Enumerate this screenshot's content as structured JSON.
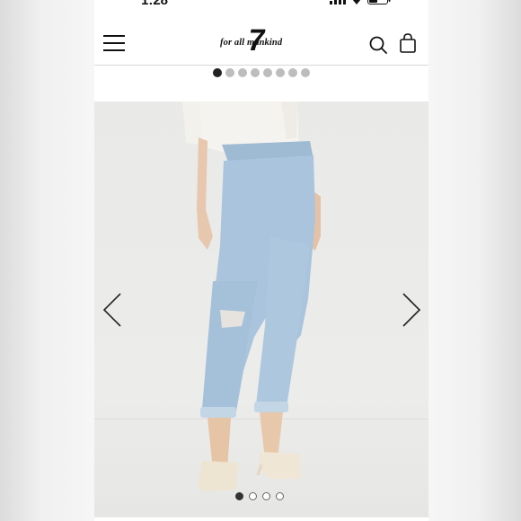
{
  "status_bar": {
    "time": "1:28",
    "icons": [
      "signal-icon",
      "wifi-icon",
      "battery-icon"
    ]
  },
  "header": {
    "logo_text": "for all mankind",
    "logo_seven": "7",
    "icons": [
      "menu-icon",
      "search-icon",
      "shopping-bag-icon"
    ]
  },
  "thumbnail_pager": {
    "count": 8,
    "active_index": 0
  },
  "product_gallery": {
    "image_alt": "model wearing light wash distressed boyfriend jeans with cuffed hems and cream mules",
    "nav": [
      "chevron-left-icon",
      "chevron-right-icon"
    ],
    "pager": {
      "count": 4,
      "active_index": 0
    }
  },
  "colors": {
    "accent": "#222222",
    "denim": "#a9c4dc",
    "background": "#ffffff"
  }
}
